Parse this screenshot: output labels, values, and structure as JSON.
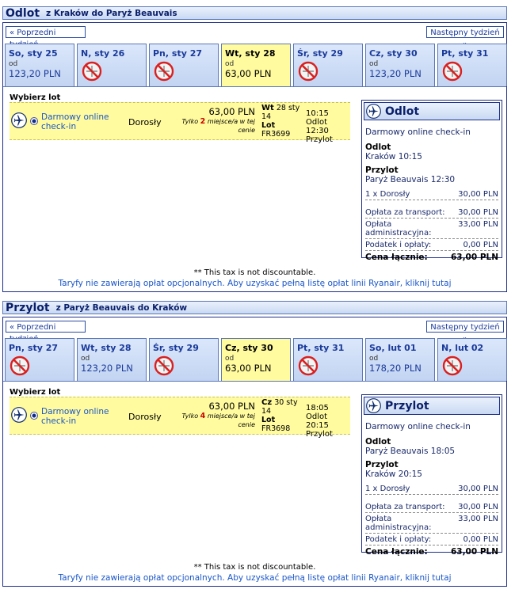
{
  "outbound": {
    "title": "Odlot",
    "route": "z Kraków do Paryż Beauvais",
    "prev_week": "« Poprzedni tydzień",
    "next_week": "Następny tydzień »",
    "days": [
      {
        "label": "So, sty 25",
        "from": "od",
        "price": "123,20 PLN",
        "available": true,
        "selected": false
      },
      {
        "label": "N, sty 26",
        "available": false,
        "selected": false
      },
      {
        "label": "Pn, sty 27",
        "available": false,
        "selected": false
      },
      {
        "label": "Wt, sty 28",
        "from": "od",
        "price": "63,00 PLN",
        "available": true,
        "selected": true
      },
      {
        "label": "Śr, sty 29",
        "available": false,
        "selected": false
      },
      {
        "label": "Cz, sty 30",
        "from": "od",
        "price": "123,20 PLN",
        "available": true,
        "selected": false
      },
      {
        "label": "Pt, sty 31",
        "available": false,
        "selected": false
      }
    ],
    "pick_label": "Wybierz lot",
    "fare": {
      "checkin": "Darmowy online check-in",
      "pax": "Dorosły",
      "price": "63,00 PLN",
      "note_pre": "Tylko",
      "seats": "2",
      "note_post": "miejsce/a w tej cenie",
      "day_abbr": "Wt",
      "date": "28 sty 14",
      "flight_label": "Lot",
      "flight_no": "FR3699",
      "depart": "10:15 Odlot",
      "arrive": "12:30 Przylot"
    },
    "summary": {
      "title": "Odlot",
      "checkin": "Darmowy online check-in",
      "dep_label": "Odlot",
      "dep_value": "Kraków 10:15",
      "arr_label": "Przylot",
      "arr_value": "Paryż Beauvais 12:30",
      "lines": [
        {
          "label": "1 x Dorosły",
          "value": "30,00 PLN"
        },
        {
          "label": "Opłata za transport:",
          "value": "30,00 PLN"
        },
        {
          "label": "Opłata administracyjna:",
          "value": "33,00 PLN"
        },
        {
          "label": "Podatek i opłaty:",
          "value": "0,00 PLN"
        }
      ],
      "total_label": "Cena łącznie:",
      "total_value": "63,00 PLN"
    },
    "tax_note": "** This tax is not discountable.",
    "fees_link": "Taryfy nie zawierają opłat opcjonalnych. Aby uzyskać pełną listę opłat linii Ryanair, kliknij tutaj"
  },
  "inbound": {
    "title": "Przylot",
    "route": "z Paryż Beauvais do Kraków",
    "prev_week": "« Poprzedni tydzień",
    "next_week": "Następny tydzień »",
    "days": [
      {
        "label": "Pn, sty 27",
        "available": false,
        "selected": false
      },
      {
        "label": "Wt, sty 28",
        "from": "od",
        "price": "123,20 PLN",
        "available": true,
        "selected": false
      },
      {
        "label": "Śr, sty 29",
        "available": false,
        "selected": false
      },
      {
        "label": "Cz, sty 30",
        "from": "od",
        "price": "63,00 PLN",
        "available": true,
        "selected": true
      },
      {
        "label": "Pt, sty 31",
        "available": false,
        "selected": false
      },
      {
        "label": "So, lut 01",
        "from": "od",
        "price": "178,20 PLN",
        "available": true,
        "selected": false
      },
      {
        "label": "N, lut 02",
        "available": false,
        "selected": false
      }
    ],
    "pick_label": "Wybierz lot",
    "fare": {
      "checkin": "Darmowy online check-in",
      "pax": "Dorosły",
      "price": "63,00 PLN",
      "note_pre": "Tylko",
      "seats": "4",
      "note_post": "miejsce/a w tej cenie",
      "day_abbr": "Cz",
      "date": "30 sty 14",
      "flight_label": "Lot",
      "flight_no": "FR3698",
      "depart": "18:05 Odlot",
      "arrive": "20:15 Przylot"
    },
    "summary": {
      "title": "Przylot",
      "checkin": "Darmowy online check-in",
      "dep_label": "Odlot",
      "dep_value": "Paryż Beauvais 18:05",
      "arr_label": "Przylot",
      "arr_value": "Kraków 20:15",
      "lines": [
        {
          "label": "1 x Dorosły",
          "value": "30,00 PLN"
        },
        {
          "label": "Opłata za transport:",
          "value": "30,00 PLN"
        },
        {
          "label": "Opłata administracyjna:",
          "value": "33,00 PLN"
        },
        {
          "label": "Podatek i opłaty:",
          "value": "0,00 PLN"
        }
      ],
      "total_label": "Cena łącznie:",
      "total_value": "63,00 PLN"
    },
    "tax_note": "** This tax is not discountable.",
    "fees_link": "Taryfy nie zawierają opłat opcjonalnych. Aby uzyskać pełną listę opłat linii Ryanair, kliknij tutaj"
  },
  "icons": {
    "plane": "plane-icon",
    "no_flight": "no-flight-icon"
  },
  "colors": {
    "selected_day": "#fffb9e",
    "day_tab": "#c9d9f3",
    "border": "#1d2f8a",
    "link": "#1a56c8",
    "seats_highlight": "#cc0000"
  }
}
